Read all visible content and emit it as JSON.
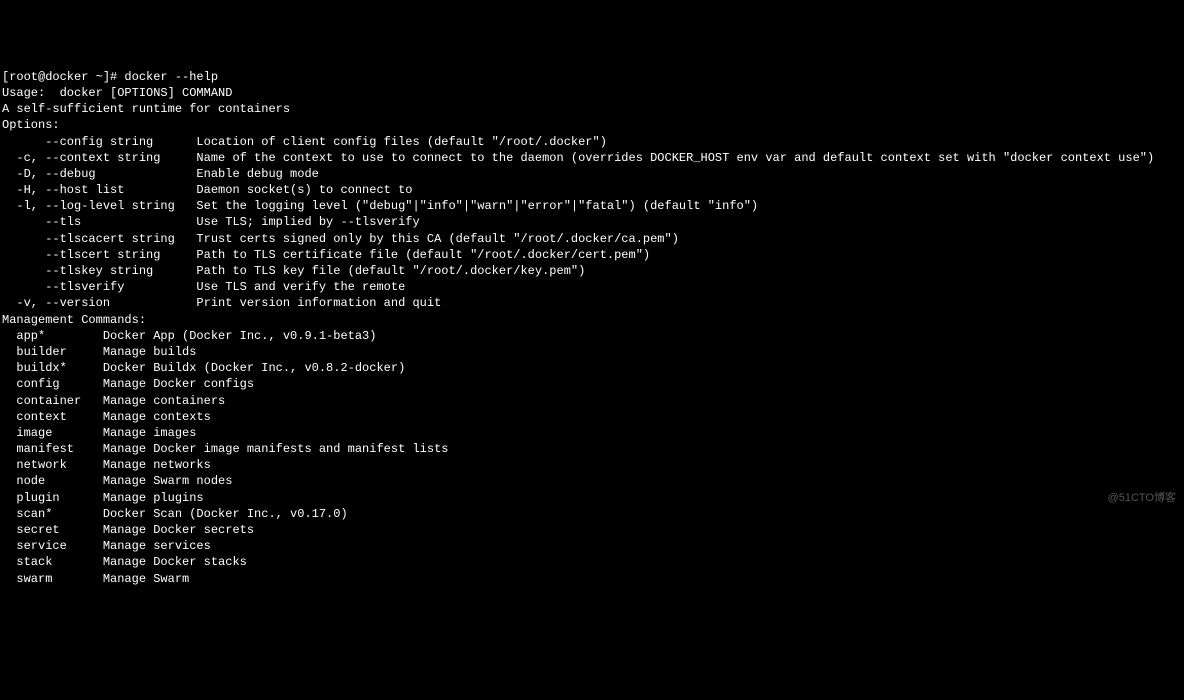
{
  "prompt": "[root@docker ~]# docker --help",
  "blank1": "",
  "usage": "Usage:  docker [OPTIONS] COMMAND",
  "blank2": "",
  "tagline": "A self-sufficient runtime for containers",
  "blank3": "",
  "options_header": "Options:",
  "options": [
    "      --config string      Location of client config files (default \"/root/.docker\")",
    "  -c, --context string     Name of the context to use to connect to the daemon (overrides DOCKER_HOST env var and default context set with \"docker context use\")",
    "  -D, --debug              Enable debug mode",
    "  -H, --host list          Daemon socket(s) to connect to",
    "  -l, --log-level string   Set the logging level (\"debug\"|\"info\"|\"warn\"|\"error\"|\"fatal\") (default \"info\")",
    "      --tls                Use TLS; implied by --tlsverify",
    "      --tlscacert string   Trust certs signed only by this CA (default \"/root/.docker/ca.pem\")",
    "      --tlscert string     Path to TLS certificate file (default \"/root/.docker/cert.pem\")",
    "      --tlskey string      Path to TLS key file (default \"/root/.docker/key.pem\")",
    "      --tlsverify          Use TLS and verify the remote",
    "  -v, --version            Print version information and quit"
  ],
  "blank4": "",
  "mgmt_header": "Management Commands:",
  "mgmt": [
    "  app*        Docker App (Docker Inc., v0.9.1-beta3)",
    "  builder     Manage builds",
    "  buildx*     Docker Buildx (Docker Inc., v0.8.2-docker)",
    "  config      Manage Docker configs",
    "  container   Manage containers",
    "  context     Manage contexts",
    "  image       Manage images",
    "  manifest    Manage Docker image manifests and manifest lists",
    "  network     Manage networks",
    "  node        Manage Swarm nodes",
    "  plugin      Manage plugins",
    "  scan*       Docker Scan (Docker Inc., v0.17.0)",
    "  secret      Manage Docker secrets",
    "  service     Manage services",
    "  stack       Manage Docker stacks",
    "  swarm       Manage Swarm"
  ],
  "watermark": "@51CTO博客"
}
